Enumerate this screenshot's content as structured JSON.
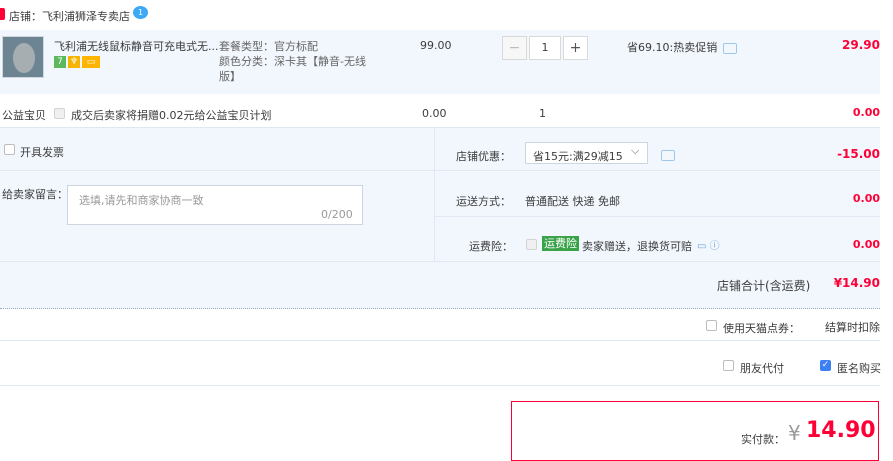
{
  "store": {
    "label": "店铺：飞利浦狮泽专卖店",
    "chat_badge": "1"
  },
  "item": {
    "title": "飞利浦无线鼠标静音可充电式无...",
    "badges": [
      "7",
      "",
      ""
    ],
    "sku_package": "套餐类型：官方标配",
    "sku_color_line1": "颜色分类：深卡其【静音-无线",
    "sku_color_line2": "版】",
    "price": "99.00",
    "quantity": "1",
    "minus": "−",
    "plus": "+",
    "promo": "省69.10:热卖促销",
    "subtotal": "29.90"
  },
  "charity": {
    "label": "公益宝贝",
    "text": "成交后卖家将捐赠0.02元给公益宝贝计划",
    "price": "0.00",
    "qty": "1",
    "total": "0.00"
  },
  "order": {
    "invoice_label": "开具发票",
    "note_label": "给卖家留言：",
    "note_placeholder": "选填,请先和商家协商一致",
    "note_count": "0/200",
    "discount_label": "店铺优惠：",
    "discount_value": "省15元:满29减15",
    "discount_total": "-15.00",
    "shipping_label": "运送方式：",
    "shipping_value": "普通配送 快递 免邮",
    "shipping_total": "0.00",
    "insurance_label": "运费险：",
    "insurance_tag": "运费险",
    "insurance_text": "卖家赠送，退换货可赔",
    "insurance_total": "0.00",
    "store_total_label": "店铺合计(含运费)",
    "store_total_value": "¥14.90"
  },
  "options": {
    "points_label": "使用天猫点券：",
    "points_right": "结算时扣除",
    "friend_pay_label": "朋友代付",
    "anonymous_label": "匿名购买"
  },
  "payment": {
    "label": "实付款：",
    "currency": "¥",
    "value": "14.90"
  },
  "colors": {
    "accent_red": "#ff0036",
    "panel_bg": "#f2f7fd",
    "insurance_green": "#3aa34a",
    "checkbox_blue": "#3d7ff5"
  }
}
